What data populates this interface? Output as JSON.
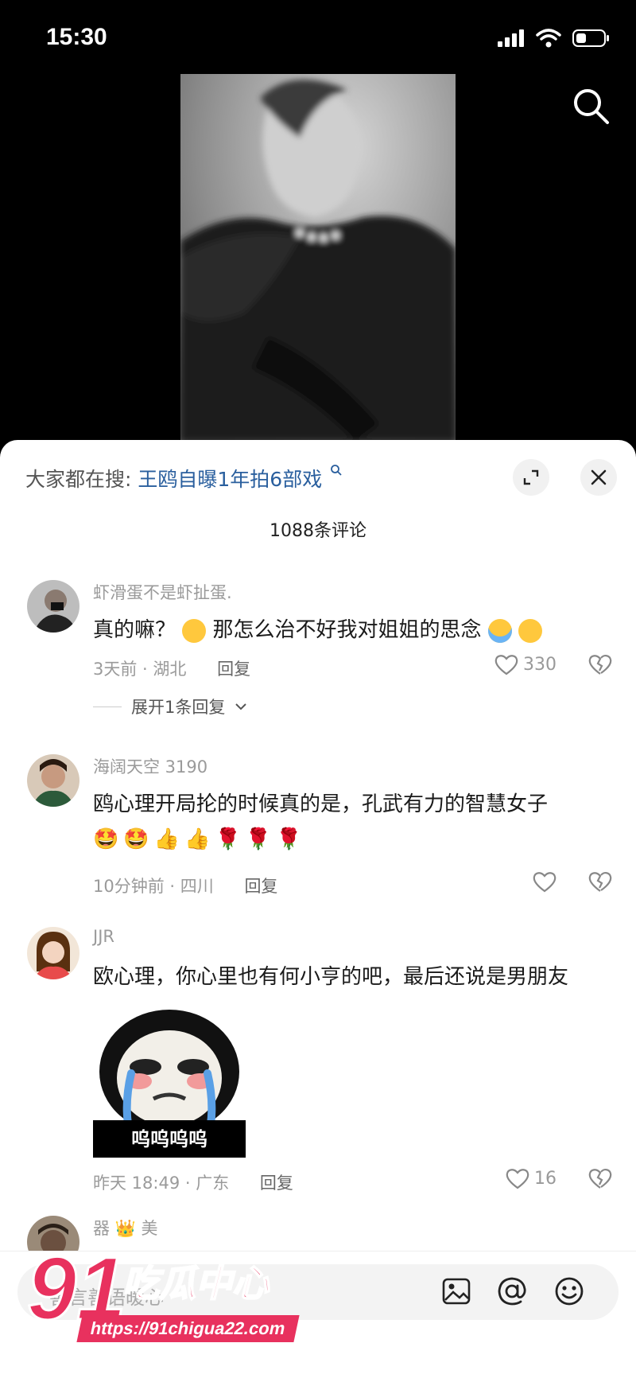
{
  "status_bar": {
    "time": "15:30"
  },
  "sheet": {
    "hot_search_prefix": "大家都在搜:",
    "hot_search_term": "王鸥自曝1年拍6部戏",
    "comment_count": "1088条评论"
  },
  "comments": [
    {
      "username": "虾滑蛋不是虾扯蛋.",
      "text": "真的嘛？",
      "text2": "那怎么治不好我对姐姐的思念",
      "time_location": "3天前 · 湖北",
      "reply_label": "回复",
      "likes": "330",
      "expand_label": "展开1条回复"
    },
    {
      "username": "海阔天空 3190",
      "text": "鸥心理开局抡的时候真的是，孔武有力的智慧女子",
      "time_location": "10分钟前 · 四川",
      "reply_label": "回复"
    },
    {
      "username": "JJR",
      "text": "欧心理，你心里也有何小亨的吧，最后还说是男朋友",
      "sticker_caption": "呜呜呜呜",
      "time_location": "昨天 18:49 · 广东",
      "reply_label": "回复",
      "likes": "16"
    },
    {
      "username": "器",
      "username2": "美"
    }
  ],
  "input_bar": {
    "placeholder": "善言善语暖心"
  },
  "watermark": {
    "number": "91",
    "text": "吃瓜中心",
    "url": "https://91chigua22.com"
  },
  "colors": {
    "accent_link": "#2a5f9e",
    "watermark": "#e8315e"
  }
}
